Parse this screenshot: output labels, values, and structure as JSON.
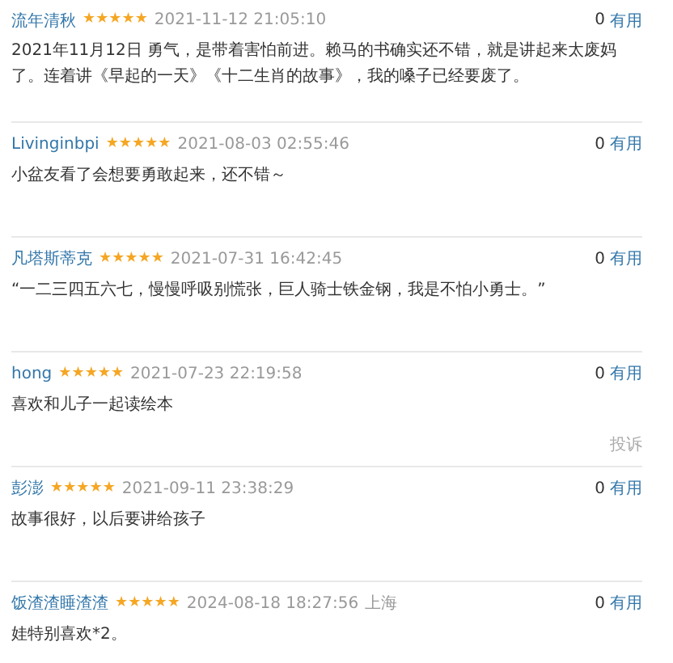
{
  "comments": [
    {
      "user": "流年清秋",
      "stars": 5,
      "time": "2021-11-12 21:05:10",
      "votes": "0",
      "vote_label": "有用",
      "text": "2021年11月12日 勇气，是带着害怕前进。赖马的书确实还不错，就是讲起来太废妈了。连着讲《早起的一天》《十二生肖的故事》，我的嗓子已经要废了。"
    },
    {
      "user": "Livinginbpi",
      "stars": 5,
      "time": "2021-08-03 02:55:46",
      "votes": "0",
      "vote_label": "有用",
      "text": "小盆友看了会想要勇敢起来，还不错～"
    },
    {
      "user": "凡塔斯蒂克",
      "stars": 5,
      "time": "2021-07-31 16:42:45",
      "votes": "0",
      "vote_label": "有用",
      "text": "“一二三四五六七，慢慢呼吸别慌张，巨人骑士铁金钢，我是不怕小勇士。”"
    },
    {
      "user": "hong",
      "stars": 5,
      "time": "2021-07-23 22:19:58",
      "votes": "0",
      "vote_label": "有用",
      "text": "喜欢和儿子一起读绘本",
      "report": "投诉"
    },
    {
      "user": "彭澎",
      "stars": 5,
      "time": "2021-09-11 23:38:29",
      "votes": "0",
      "vote_label": "有用",
      "text": "故事很好，以后要讲给孩子"
    },
    {
      "user": "饭渣渣睡渣渣",
      "stars": 5,
      "time": "2024-08-18 18:27:56",
      "location": "上海",
      "votes": "0",
      "vote_label": "有用",
      "text": "娃特别喜欢*2。"
    }
  ]
}
